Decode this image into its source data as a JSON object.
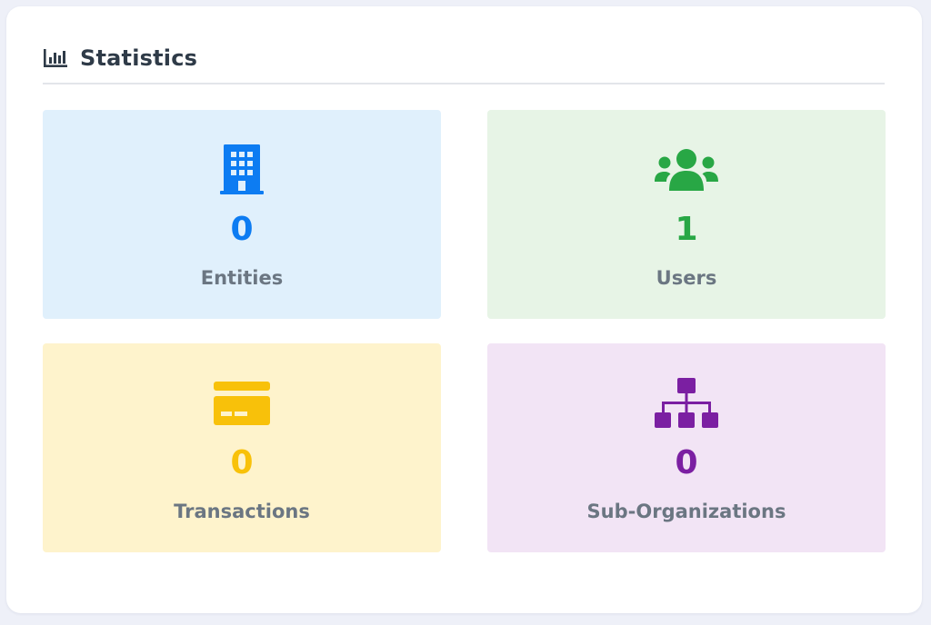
{
  "header": {
    "title": "Statistics",
    "icon": "bar-chart-icon",
    "title_color": "#2f3b48"
  },
  "stats": [
    {
      "label": "Entities",
      "value": "0",
      "icon": "building-icon",
      "accent": "#0d7cf2",
      "background": "#e0f0fc"
    },
    {
      "label": "Users",
      "value": "1",
      "icon": "users-icon",
      "accent": "#28a745",
      "background": "#e7f4e6"
    },
    {
      "label": "Transactions",
      "value": "0",
      "icon": "credit-card-icon",
      "accent": "#f8c10a",
      "background": "#fef3cc"
    },
    {
      "label": "Sub-Organizations",
      "value": "0",
      "icon": "sitemap-icon",
      "accent": "#7b1fa2",
      "background": "#f2e4f5"
    }
  ]
}
